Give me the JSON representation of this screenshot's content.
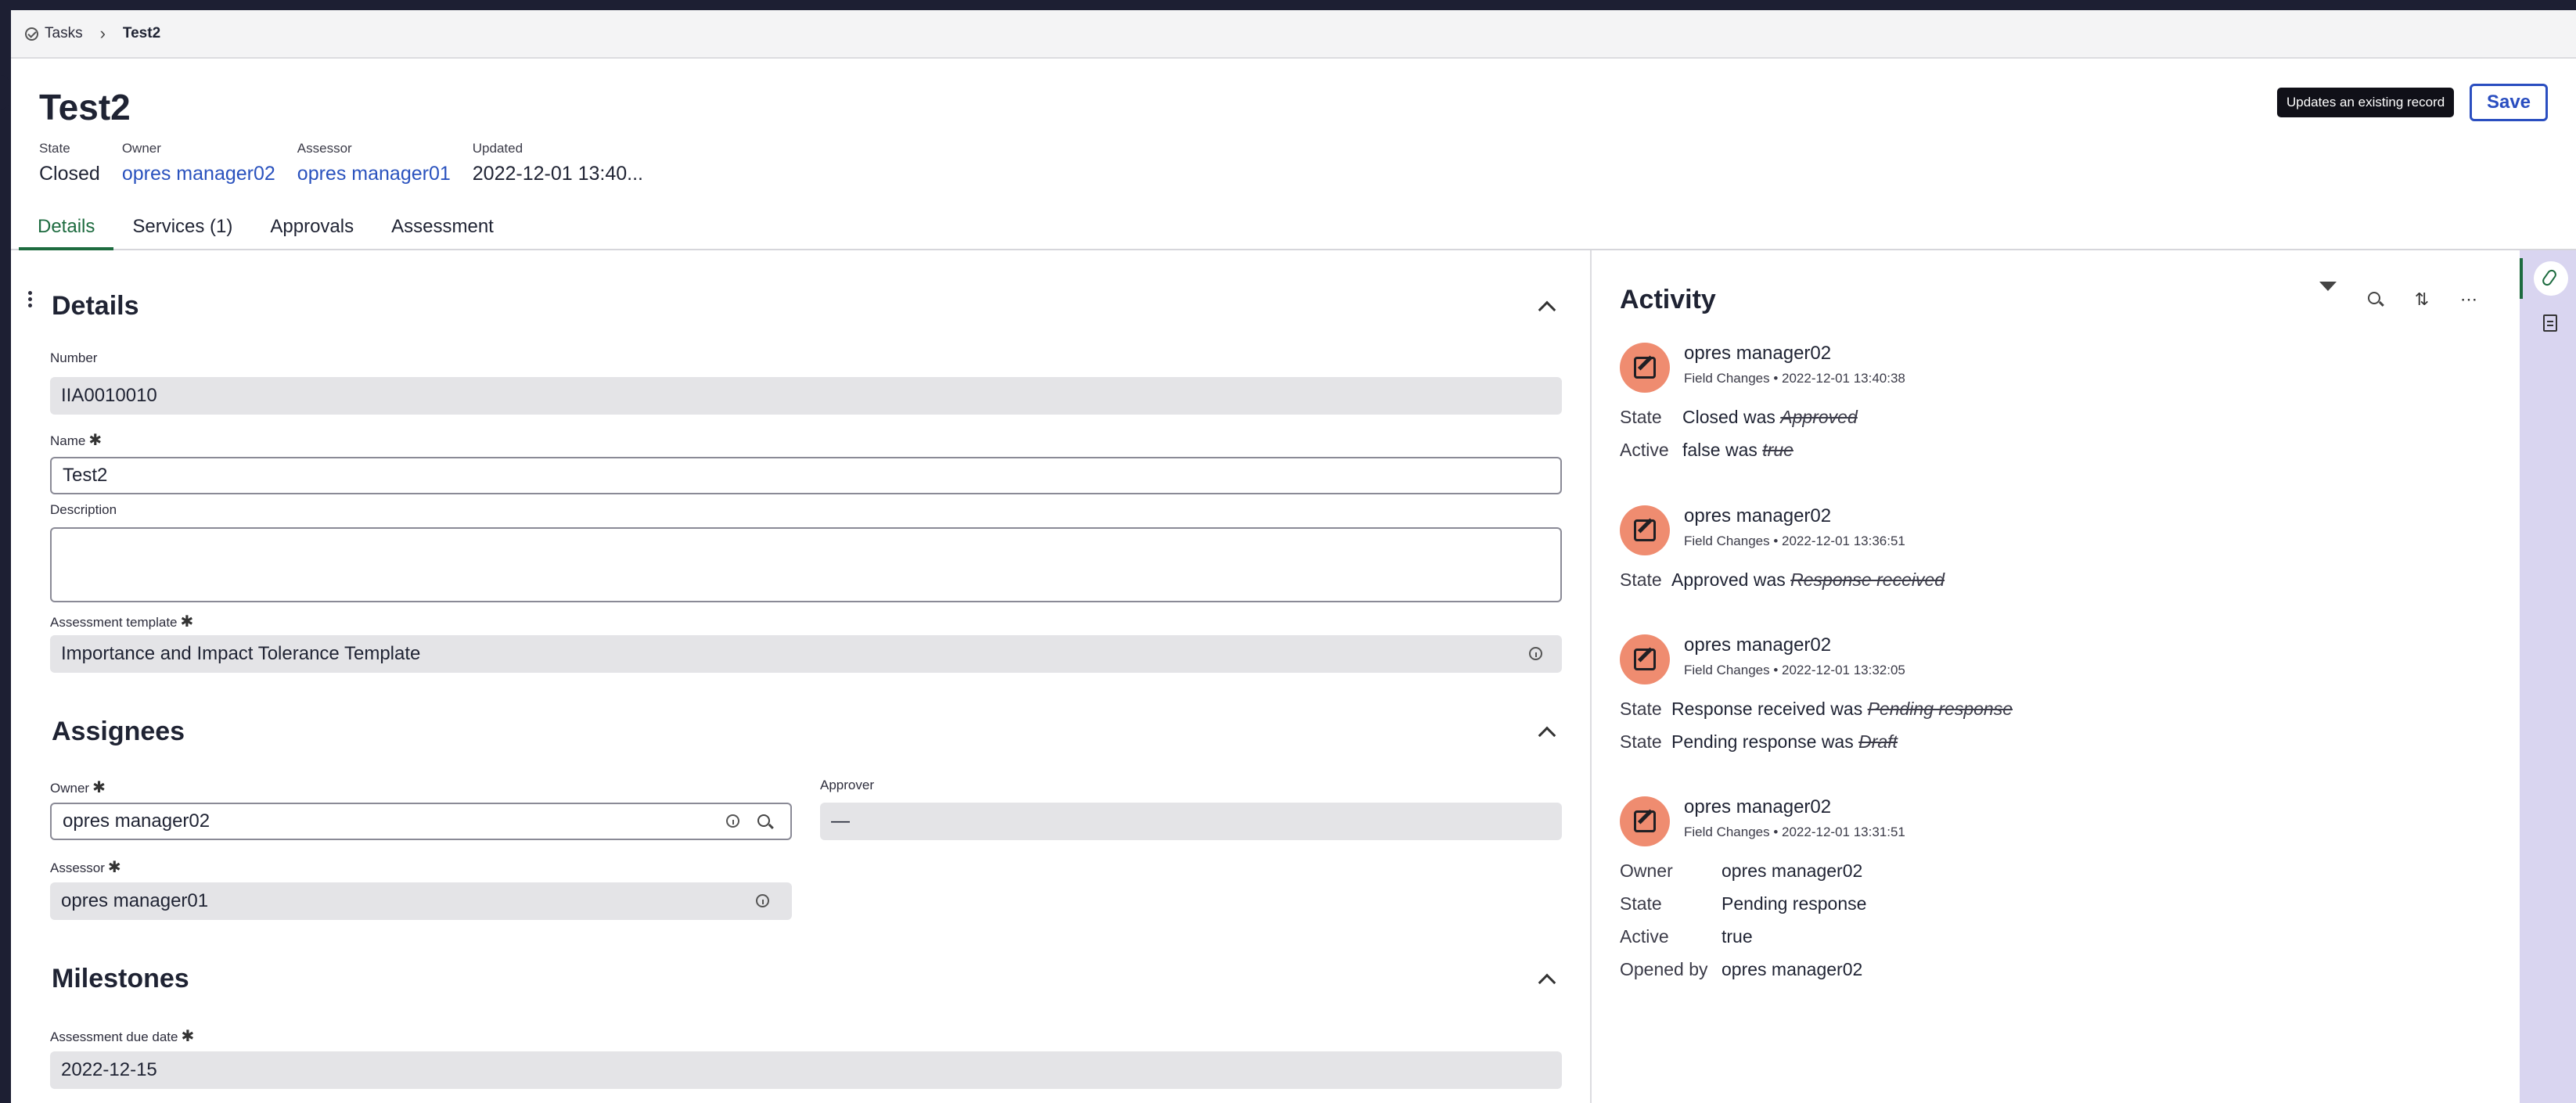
{
  "breadcrumb": {
    "parent": "Tasks",
    "current": "Test2",
    "parent_icon": "check-circle-icon"
  },
  "record": {
    "title": "Test2",
    "meta": [
      {
        "label": "State",
        "value": "Closed"
      },
      {
        "label": "Owner",
        "value": "opres manager02"
      },
      {
        "label": "Assessor",
        "value": "opres manager01"
      },
      {
        "label": "Updated",
        "value": "2022-12-01 13:40..."
      }
    ],
    "tooltip": "Updates an existing record",
    "save_label": "Save"
  },
  "tabs": [
    "Details",
    "Services (1)",
    "Approvals",
    "Assessment"
  ],
  "details": {
    "title": "Details",
    "number_label": "Number",
    "number_value": "IIA0010010",
    "name_label": "Name",
    "name_value": "Test2",
    "description_label": "Description",
    "description_value": "",
    "template_label": "Assessment template",
    "template_value": "Importance and Impact Tolerance Template"
  },
  "assignees": {
    "title": "Assignees",
    "owner_label": "Owner",
    "owner_value": "opres manager02",
    "approver_label": "Approver",
    "approver_value": "—",
    "assessor_label": "Assessor",
    "assessor_value": "opres manager01"
  },
  "milestones": {
    "title": "Milestones",
    "due_label": "Assessment due date",
    "due_value": "2022-12-15"
  },
  "required_mark": "✱",
  "activity": {
    "title": "Activity",
    "entries": [
      {
        "user": "opres manager02",
        "meta": "Field Changes • 2022-12-01 13:40:38",
        "changes": [
          {
            "field": "State",
            "new": "Closed",
            "was": "was",
            "old": "Approved"
          },
          {
            "field": "Active",
            "new": "false",
            "was": "was",
            "old": "true"
          }
        ]
      },
      {
        "user": "opres manager02",
        "meta": "Field Changes • 2022-12-01 13:36:51",
        "changes": [
          {
            "field": "State",
            "new": "Approved",
            "was": "was",
            "old": "Response received"
          }
        ]
      },
      {
        "user": "opres manager02",
        "meta": "Field Changes • 2022-12-01 13:32:05",
        "changes": [
          {
            "field": "State",
            "new": "Response received",
            "was": "was",
            "old": "Pending response"
          },
          {
            "field": "State",
            "new": "Pending response",
            "was": "was",
            "old": "Draft"
          }
        ]
      },
      {
        "user": "opres manager02",
        "meta": "Field Changes • 2022-12-01 13:31:51",
        "fields": [
          {
            "field": "Owner",
            "value": "opres manager02"
          },
          {
            "field": "State",
            "value": "Pending response"
          },
          {
            "field": "Active",
            "value": "true"
          },
          {
            "field": "Opened by",
            "value": "opres manager02"
          }
        ]
      }
    ]
  }
}
